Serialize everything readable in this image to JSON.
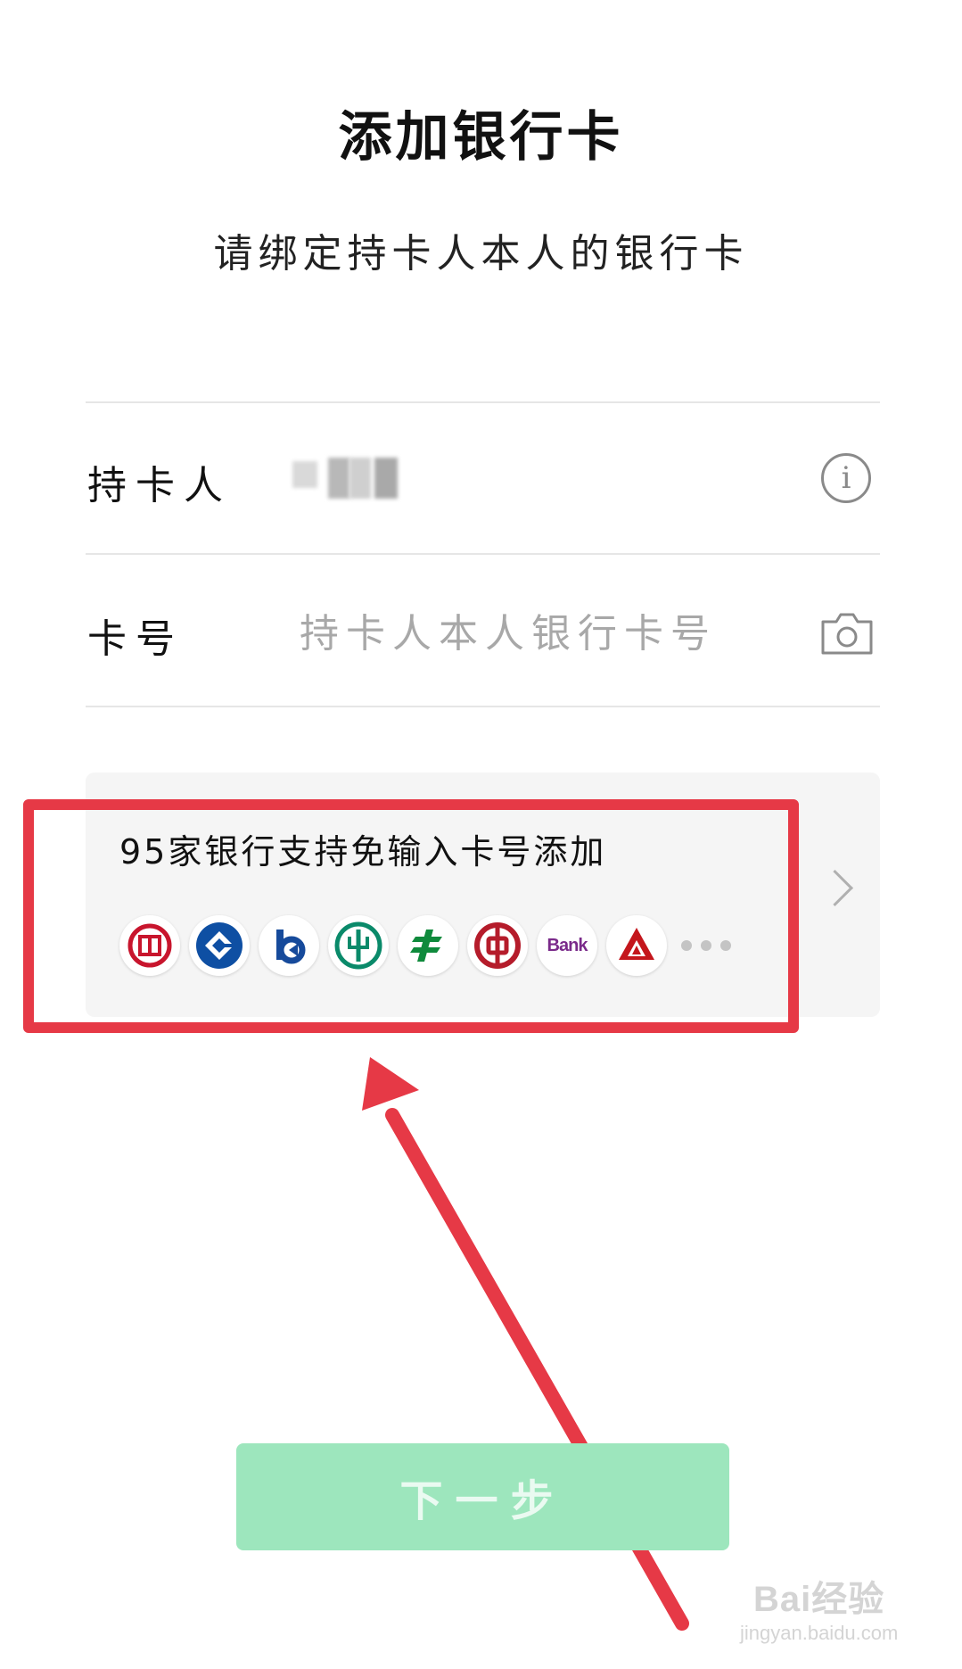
{
  "header": {
    "title": "添加银行卡",
    "subtitle": "请绑定持卡人本人的银行卡"
  },
  "form": {
    "holder_label": "持卡人",
    "card_label": "卡号",
    "card_placeholder": "持卡人本人银行卡号"
  },
  "banks": {
    "title": "95家银行支持免输入卡号添加",
    "icons": [
      "icbc-logo-icon",
      "ccb-logo-icon",
      "bocom-logo-icon",
      "abc-logo-icon",
      "psbc-logo-icon",
      "boc-logo-icon",
      "bank-logo-icon",
      "cmb-logo-icon"
    ],
    "bank_text": "Bank"
  },
  "footer": {
    "next_label": "下一步"
  },
  "watermark": {
    "main": "Bai经验",
    "sub": "jingyan.baidu.com"
  },
  "colors": {
    "accent_red": "#e63946",
    "button_green": "#9de6bd",
    "panel_bg": "#f5f5f5"
  }
}
